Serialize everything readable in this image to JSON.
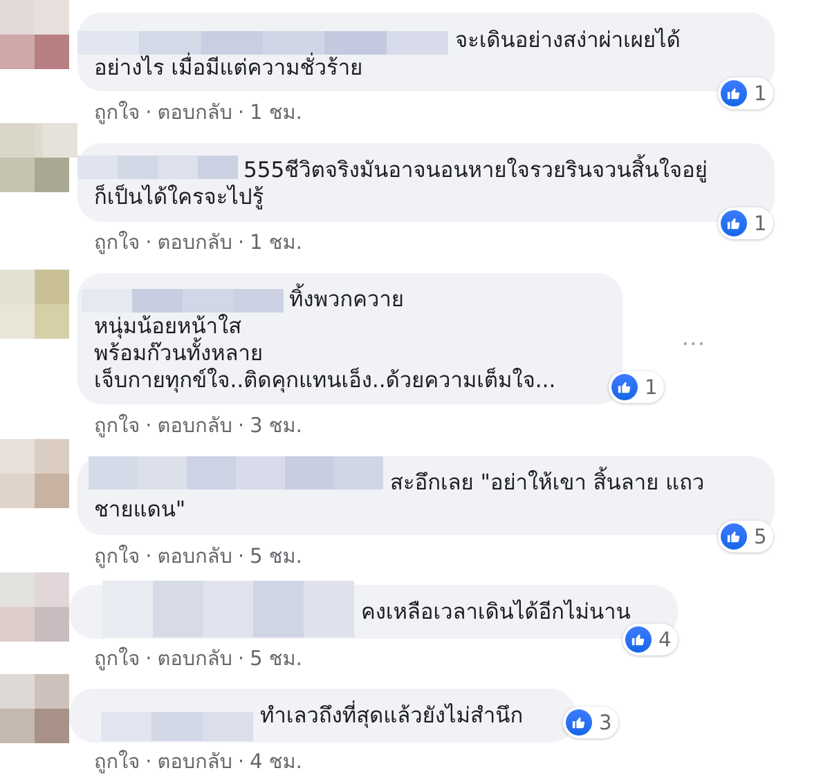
{
  "colors": {
    "bubble_bg": "#f0f2f5",
    "like_blue": "#1877f2",
    "meta_gray": "#65676b"
  },
  "actions": {
    "like": "ถูกใจ",
    "reply": "ตอบกลับ",
    "separator": "·"
  },
  "more_label": "...",
  "comments": [
    {
      "lines": [
        "จะเดินอย่างสง่าผ่าเผยได้",
        "อย่างไร เมื่อมีแต่ความชั่วร้าย"
      ],
      "reaction_count": "1",
      "time": "1 ชม."
    },
    {
      "lines": [
        "555ชีวิตจริงมันอาจนอนหายใจรวยรินจวนสิ้นใจอยู่",
        "ก็เป็นได้ใครจะไปรู้"
      ],
      "reaction_count": "1",
      "time": "1 ชม."
    },
    {
      "lines": [
        "ทิ้งพวกควาย",
        "หนุ่มน้อยหน้าใส",
        "พร้อมก๊วนทั้งหลาย",
        "เจ็บกายทุกข์ใจ..ติดคุกแทนเอ็ง..ด้วยความเต็มใจ..."
      ],
      "reaction_count": "1",
      "time": "3 ชม."
    },
    {
      "lines": [
        "สะอึกเลย \"อย่าให้เขา สิ้นลาย แถว",
        "ชายแดน\""
      ],
      "reaction_count": "5",
      "time": "5 ชม."
    },
    {
      "lines": [
        "คงเหลือเวลาเดินได้อีกไม่นาน"
      ],
      "reaction_count": "4",
      "time": "5 ชม."
    },
    {
      "lines": [
        "ทำเลวถึงที่สุดแล้วยังไม่สำนึก"
      ],
      "reaction_count": "3",
      "time": "4 ชม."
    }
  ]
}
